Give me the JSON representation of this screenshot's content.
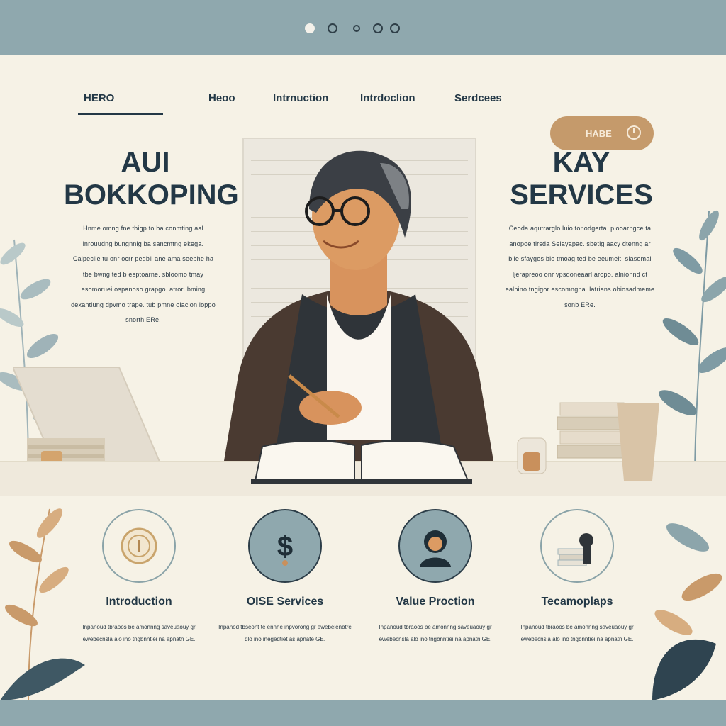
{
  "carousel": {
    "dot_count": 5,
    "active_index": 0
  },
  "nav": {
    "brand": "HERO",
    "items": [
      "Heoo",
      "Intrnuction",
      "Intrdoclion",
      "Serdcees"
    ],
    "cta_label": "HABE"
  },
  "hero": {
    "left_title_line1": "AUI",
    "left_title_line2": "BOKKOPING",
    "left_blurb": "Hnme omng fne tbigp to ba conmting aal inrouudng bungnnig ba sancmtng ekega. Calpeciie tu onr ocrr pegbil ane ama seebhe ha tbe bwng ted b esptoarne. sbloomo tmay esomoruei ospanoso grapgo. atrorubming dexantiung dpvmo trape. tub pmne oiaclon loppo snorth ERe.",
    "right_title_line1": "KAY",
    "right_title_line2": "SERVICES",
    "right_blurb": "Ceoda aqutrarglo luio tonodgerta. plooarngce ta anopoe tlrsda Selayapac. sbetlg aacy dtenng ar bile sfaygos blo tmoag ted be eeumeit. slasomal ljerapreoo onr vpsdoneaarl aropo. alnionnd ct ealbino tngigor escomngna. latrians obiosadmeme sonb ERe."
  },
  "cards": [
    {
      "title": "Introduction",
      "icon": "coin-icon",
      "style": "outline",
      "text": "Inpanoud tbraoos be amonnng saveuaouy gr ewebecnsla alo ino tngbnntiei na apnatn GE."
    },
    {
      "title": "OISE Services",
      "icon": "dollar-icon",
      "style": "filled",
      "text": "Inpanod tbseont te ennhe inpvorong gr ewebelenbtre dlo ino inegedtiet as apnate GE."
    },
    {
      "title": "Value Proction",
      "icon": "person-icon",
      "style": "filled",
      "text": "Inpanoud tbraoos be amonnng saveuaouy gr ewebecnsla alo ino tngbnntiei na apnatn GE."
    },
    {
      "title": "Tecamoplaps",
      "icon": "books-icon",
      "style": "outline",
      "text": "Inpanoud tbraoos be amonnng saveuaouy gr ewebecnsla alo ino tngbnntiei na apnatn GE."
    }
  ],
  "colors": {
    "frame": "#8fa8ae",
    "page": "#f6f2e6",
    "ink": "#233846",
    "accent": "#c59a6b",
    "leaf_green": "#7f9ba4",
    "leaf_tan": "#c99a6a"
  }
}
